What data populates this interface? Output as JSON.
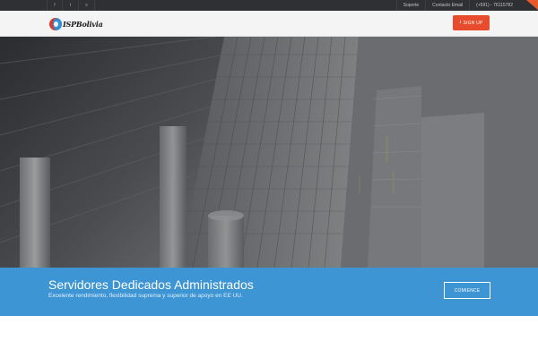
{
  "topbar": {
    "social": [
      {
        "icon": "facebook-icon",
        "glyph": "f"
      },
      {
        "icon": "twitter-icon",
        "glyph": "t"
      },
      {
        "icon": "skype-icon",
        "glyph": "s"
      }
    ],
    "links": {
      "support": "Soporte",
      "email": "Contacto Email",
      "phone": "(+591) - 76115782"
    },
    "ribbon_color": "#e85a2c"
  },
  "header": {
    "logo_text": "ISPBolivia",
    "signup_label": "SIGN UP",
    "signup_icon": "download-icon",
    "accent_color": "#e74c2c"
  },
  "banner": {
    "title": "Servidores Dedicados Administrados",
    "subtitle": "Excelente rendimiento, flexibilidad suprema y superior de apoyo en EE UU.",
    "button_label": "COMIENCE",
    "background_color": "#3d95d4"
  }
}
